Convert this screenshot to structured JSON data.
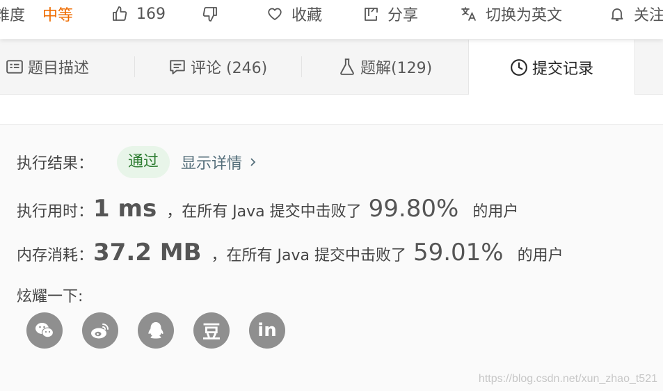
{
  "topbar": {
    "difficulty_label": "难度",
    "difficulty_value": "中等",
    "like_count": "169",
    "favorite_label": "收藏",
    "share_label": "分享",
    "language_label": "切换为英文",
    "follow_label": "关注"
  },
  "tabs": [
    {
      "label": "题目描述"
    },
    {
      "label": "评论 (246)"
    },
    {
      "label": "题解(129)"
    },
    {
      "label": "提交记录"
    }
  ],
  "result": {
    "status_label": "执行结果：",
    "status_value": "通过",
    "detail_link": "显示详情",
    "time_label": "执行用时：",
    "time_value": "1 ms",
    "time_text": "，在所有 Java 提交中击败了",
    "time_percent": "99.80%",
    "time_suffix": "的用户",
    "memory_label": "内存消耗：",
    "memory_value": "37.2 MB",
    "memory_text": "，在所有 Java 提交中击败了",
    "memory_percent": "59.01%",
    "memory_suffix": "的用户",
    "share_label": "炫耀一下:"
  },
  "social": [
    "wechat-icon",
    "weibo-icon",
    "qq-icon",
    "douban-icon",
    "linkedin-icon"
  ],
  "social_text": {
    "douban": "豆",
    "linkedin": "in"
  },
  "watermark": "https://blog.csdn.net/xun_zhao_t521",
  "colors": {
    "accent_orange": "#ef6c00",
    "success_green": "#2e7d32",
    "success_bg": "#e8f5e9",
    "icon_gray": "#8f8f8f"
  }
}
